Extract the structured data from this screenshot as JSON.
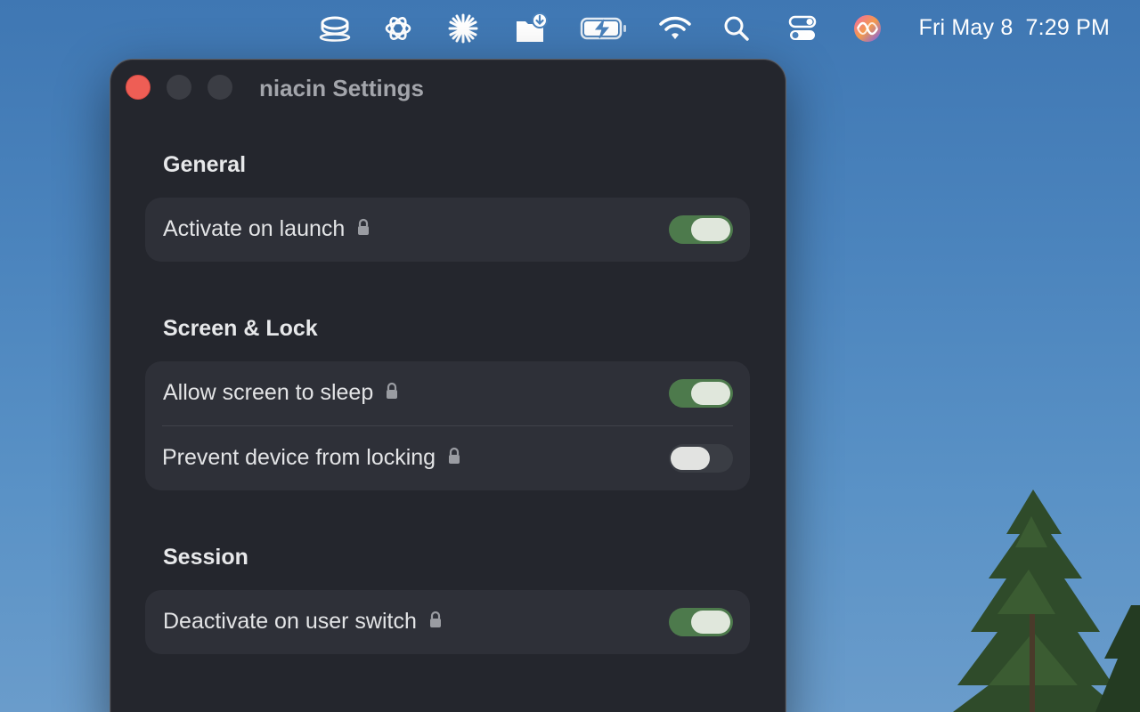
{
  "menubar": {
    "icons": [
      "cup-icon",
      "chatgpt-icon",
      "asterisk-icon",
      "folder-download-icon",
      "battery-charging-icon",
      "wifi-icon",
      "search-icon",
      "control-center-icon",
      "siri-icon"
    ],
    "date": "Fri May 8",
    "time": "7:29 PM"
  },
  "window": {
    "title": "niacin Settings",
    "sections": [
      {
        "title": "General",
        "rows": [
          {
            "label": "Activate on launch",
            "enabled": true
          }
        ]
      },
      {
        "title": "Screen & Lock",
        "rows": [
          {
            "label": "Allow screen to sleep",
            "enabled": true
          },
          {
            "label": "Prevent device from locking",
            "enabled": false
          }
        ]
      },
      {
        "title": "Session",
        "rows": [
          {
            "label": "Deactivate on user switch",
            "enabled": true
          }
        ]
      }
    ]
  },
  "colors": {
    "toggle_on": "#4d7a4c",
    "toggle_off": "#3a3d44",
    "window_bg": "#24262d",
    "close_button": "#ee5e55"
  }
}
